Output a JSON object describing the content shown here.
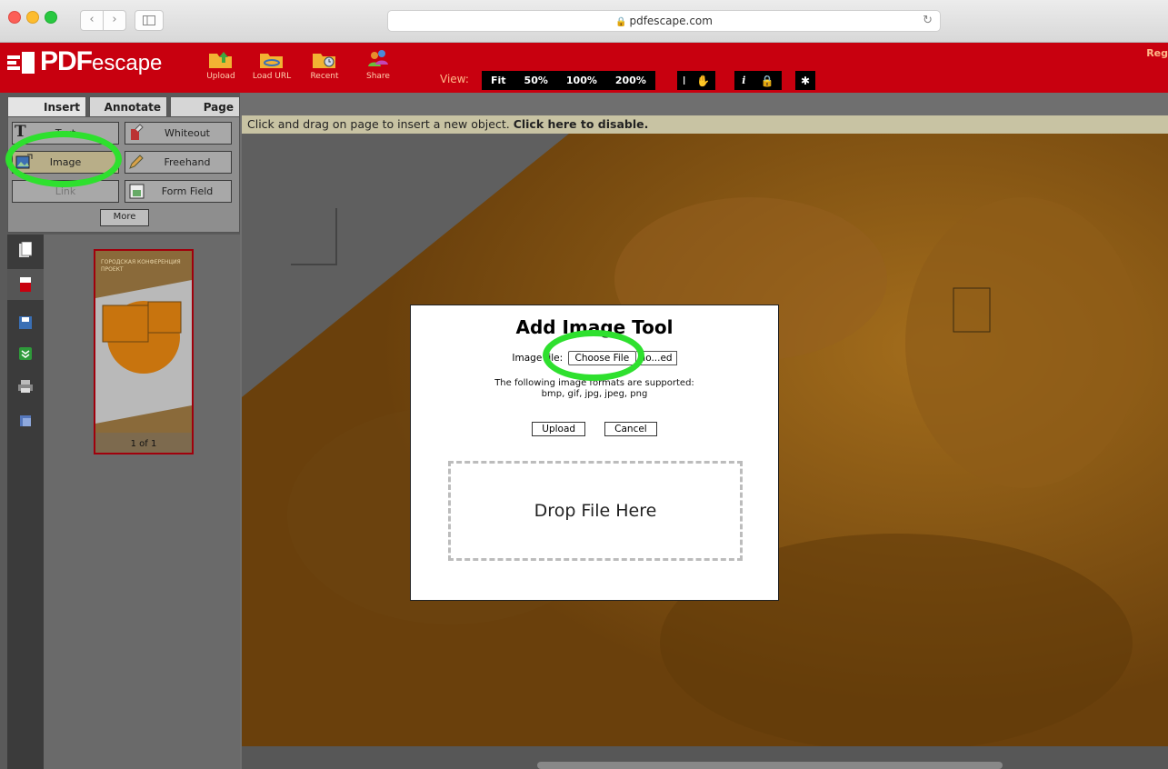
{
  "browser": {
    "url": "pdfescape.com"
  },
  "app": {
    "logo": "PDFescape",
    "toolbar": {
      "upload": "Upload",
      "load_url": "Load URL",
      "recent": "Recent",
      "share": "Share"
    },
    "view": {
      "label": "View:",
      "options": [
        "Fit",
        "50%",
        "100%",
        "200%"
      ]
    },
    "top_right": "Reg"
  },
  "left_panel": {
    "tabs": [
      "Insert",
      "Annotate",
      "Page"
    ],
    "tools": {
      "text": "Text",
      "whiteout": "Whiteout",
      "image": "Image",
      "freehand": "Freehand",
      "link": "Link",
      "form_field": "Form Field",
      "more": "More"
    },
    "thumbnail": {
      "caption": "1 of 1"
    }
  },
  "infobar": {
    "message": "Click and drag on page to insert a new object.",
    "action": "Click here to disable."
  },
  "dialog": {
    "title": "Add Image Tool",
    "file_label": "Image file:",
    "choose_file": "Choose File",
    "no_file": "no...ed",
    "formats_line1": "The following image formats are supported:",
    "formats_line2": "bmp, gif, jpg, jpeg, png",
    "upload": "Upload",
    "cancel": "Cancel",
    "drop": "Drop File Here"
  },
  "colors": {
    "brand_red": "#c8000f",
    "highlight_green": "#2ee02e",
    "document_tint": "#7a4d12"
  }
}
